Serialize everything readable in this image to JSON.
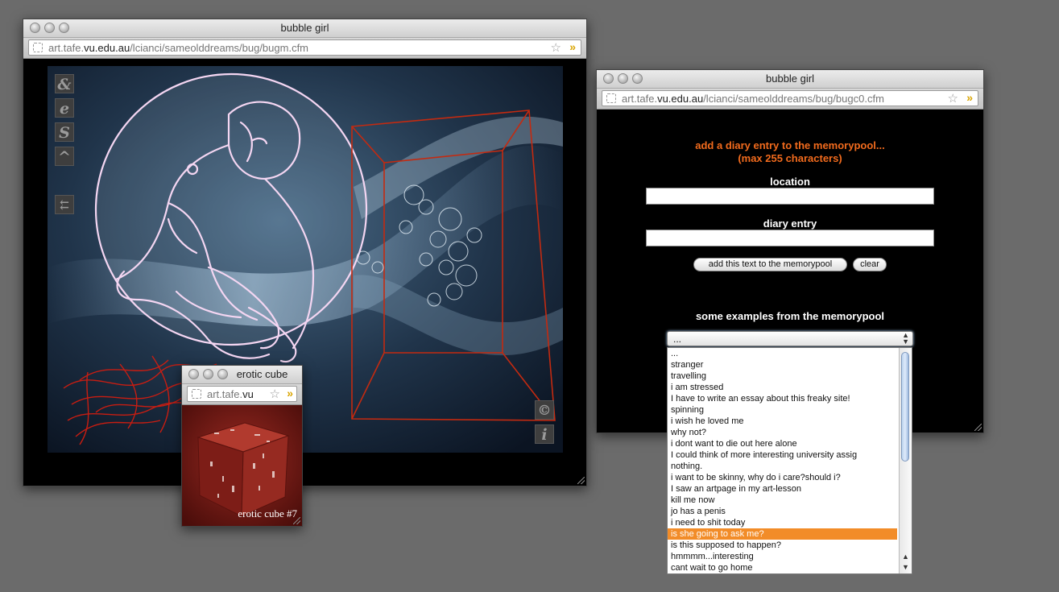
{
  "main_window": {
    "title": "bubble girl",
    "url_host": "art.tafe.",
    "url_domain": "vu.edu.au",
    "url_path": "/lcianci/sameolddreams/bug/bugm.cfm",
    "side_icons": [
      "&",
      "e",
      "S",
      "^",
      "⇇"
    ],
    "corner_icons": [
      "©",
      "i"
    ]
  },
  "diary_window": {
    "title": "bubble girl",
    "url_host": "art.tafe.",
    "url_domain": "vu.edu.au",
    "url_path": "/lcianci/sameolddreams/bug/bugc0.cfm",
    "heading_line1": "add a diary entry to the memorypool...",
    "heading_line2": "(max 255 characters)",
    "location_label": "location",
    "location_value": "",
    "diary_label": "diary entry",
    "diary_value": "",
    "add_button": "add this text to the memorypool",
    "clear_button": "clear",
    "examples_label": "some examples from the memorypool",
    "select_value": "..."
  },
  "memorypool_options": [
    "...",
    "stranger",
    "travelling",
    "i am stressed",
    "I have to write an essay about this freaky site!",
    "spinning",
    "i wish he loved me",
    "why not?",
    "i dont want to die out here alone",
    "I could think of more interesting university assig",
    "nothing.",
    "i want to be skinny, why do i care?should i?",
    "I saw an artpage in my art-lesson",
    "kill me now",
    "jo has a penis",
    "i need to shit today",
    "is she going to ask me?",
    "is this supposed to happen?",
    "hmmmm...interesting",
    "cant wait to go home"
  ],
  "highlighted_option": "is she going to ask me?",
  "cube_window": {
    "title": "erotic cube",
    "url_host": "art.tafe.",
    "url_domain": "vu",
    "caption": "erotic cube #7"
  },
  "colors": {
    "desktop": "#6b6b6b",
    "heading": "#f26b1d",
    "highlight": "#f28c28",
    "sketch_outline": "#f4d6f2",
    "box_outline": "#c42a10"
  }
}
